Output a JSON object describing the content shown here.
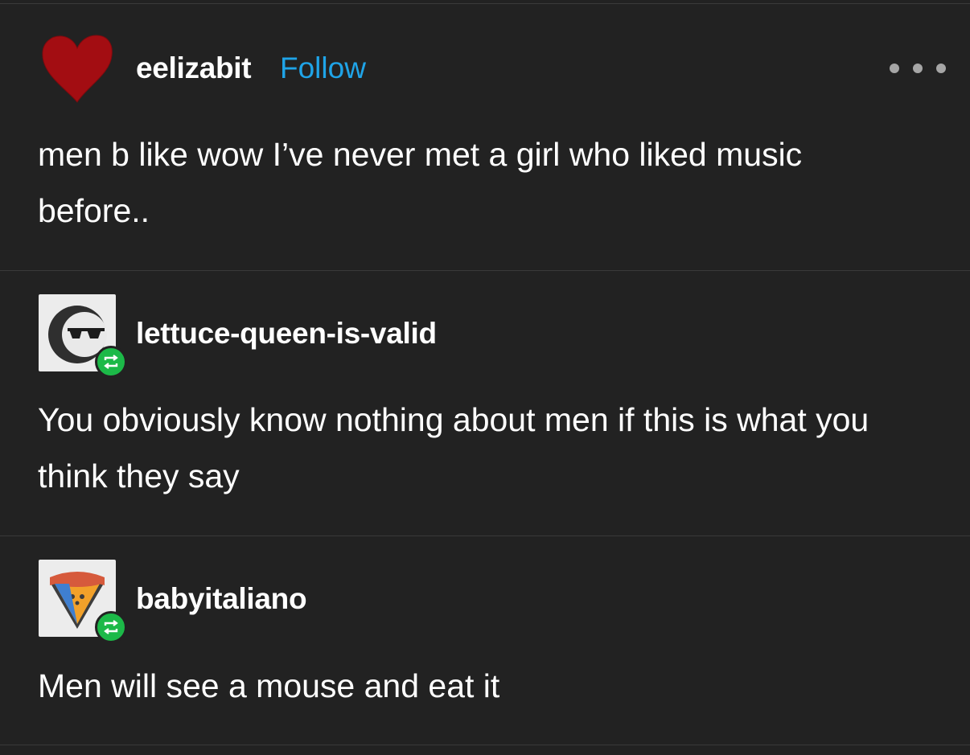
{
  "post": {
    "author": "eelizabit",
    "follow_label": "Follow",
    "more_icon": "more-horizontal-icon",
    "text": "men b like wow I’ve never met a girl who liked music before..",
    "avatar_icon": "heart-icon",
    "accent_color": "#1fa4e8"
  },
  "reblogs": [
    {
      "author": "lettuce-queen-is-valid",
      "text": "You obviously know nothing about men if this is what you think they say",
      "avatar_icon": "sunglasses-face-icon",
      "badge_icon": "reblog-icon"
    },
    {
      "author": "babyitaliano",
      "text": "Men will see a mouse and eat it",
      "avatar_icon": "pizza-slice-icon",
      "badge_icon": "reblog-icon"
    }
  ],
  "colors": {
    "background": "#222222",
    "text": "#ffffff",
    "divider": "#3a3a3a",
    "reblog_badge": "#1cb948",
    "heart": "#a30d12"
  }
}
